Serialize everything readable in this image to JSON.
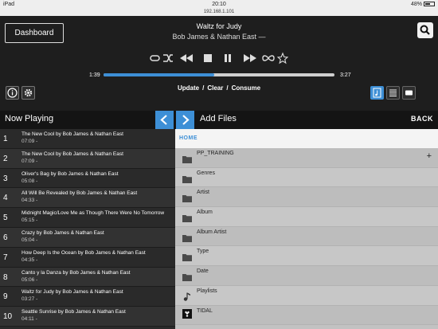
{
  "status_bar": {
    "device": "iPad",
    "time": "20:10",
    "battery": "48%"
  },
  "url": "192.168.1.101",
  "header": {
    "dashboard_label": "Dashboard",
    "song_title": "Waltz for Judy",
    "song_artist": "Bob James & Nathan East —",
    "time_elapsed": "1:39",
    "time_total": "3:27",
    "progress": 0.48,
    "queue_actions": [
      "Update",
      "Clear",
      "Consume"
    ]
  },
  "sections": {
    "now_playing": "Now Playing",
    "add_files": "Add Files",
    "back": "BACK",
    "home": "HOME"
  },
  "queue": [
    {
      "num": "1",
      "title": "The New Cool by Bob James & Nathan East",
      "time": "07:09 -"
    },
    {
      "num": "2",
      "title": "The New Cool by Bob James & Nathan East",
      "time": "07:09 -"
    },
    {
      "num": "3",
      "title": "Oliver's Bag by Bob James & Nathan East",
      "time": "05:08 -"
    },
    {
      "num": "4",
      "title": "All Will Be Revealed by Bob James & Nathan East",
      "time": "04:33 -"
    },
    {
      "num": "5",
      "title": "Midnight Magic/Love Me as Though There Were No Tomorrow",
      "time": "05:15 -"
    },
    {
      "num": "6",
      "title": "Crazy by Bob James & Nathan East",
      "time": "05:04 -"
    },
    {
      "num": "7",
      "title": "How Deep Is the Ocean by Bob James & Nathan East",
      "time": "04:35 -"
    },
    {
      "num": "8",
      "title": "Canto y la Danza by Bob James & Nathan East",
      "time": "05:06 -"
    },
    {
      "num": "9",
      "title": "Waltz for Judy by Bob James & Nathan East",
      "time": "03:27 -"
    },
    {
      "num": "10",
      "title": "Seattle Sunrise by Bob James & Nathan East",
      "time": "04:11 -"
    }
  ],
  "files": [
    {
      "label": "PP_TRAINING",
      "icon": "folder-icon"
    },
    {
      "label": "Genres",
      "icon": "folder-icon"
    },
    {
      "label": "Artist",
      "icon": "folder-icon"
    },
    {
      "label": "Album",
      "icon": "folder-icon"
    },
    {
      "label": "Album Artist",
      "icon": "folder-icon"
    },
    {
      "label": "Type",
      "icon": "folder-icon"
    },
    {
      "label": "Date",
      "icon": "folder-icon"
    },
    {
      "label": "Playlists",
      "icon": "music-note-icon"
    },
    {
      "label": "TIDAL",
      "icon": "tidal-icon"
    }
  ],
  "colors": {
    "accent": "#3d8fd6",
    "background": "#1e1e1e",
    "files_bg": "#c2c2c2"
  }
}
